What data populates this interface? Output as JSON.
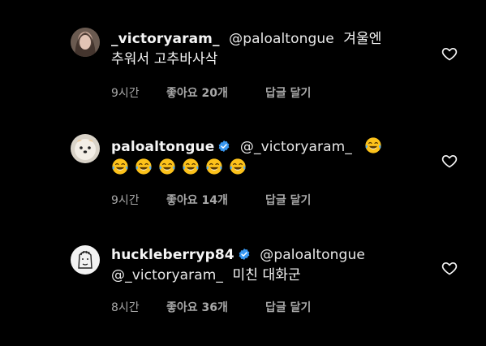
{
  "comments": [
    {
      "username": "_victoryaram_",
      "verified": false,
      "mention": "@paloaltongue",
      "text_line1": "겨울엔",
      "text_line2": "추워서 고추바사삭",
      "time": "9시간",
      "likes": "좋아요 20개",
      "reply": "답글 달기"
    },
    {
      "username": "paloaltongue",
      "verified": true,
      "mention": "@_victoryaram_",
      "emoji_count": 7,
      "emoji_name": "tears-of-joy-emoji",
      "time": "9시간",
      "likes": "좋아요 14개",
      "reply": "답글 달기"
    },
    {
      "username": "huckleberryp84",
      "verified": true,
      "mention": "@paloaltongue",
      "mention2": "@_victoryaram_",
      "text": "미친 대화군",
      "time": "8시간",
      "likes": "좋아요 36개",
      "reply": "답글 달기"
    }
  ],
  "colors": {
    "background": "#000000",
    "text": "#f5f5f5",
    "meta": "#a8a8a8",
    "verified": "#3897f0"
  },
  "icons": [
    "heart-outline-icon",
    "verified-badge-icon"
  ]
}
